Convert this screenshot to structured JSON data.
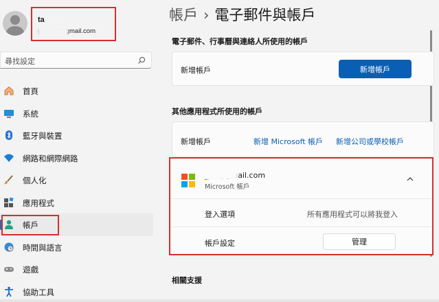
{
  "profile": {
    "name": "ta ",
    "email": "g        01@gmail.com"
  },
  "search": {
    "placeholder": "尋找設定",
    "icon": "search-icon"
  },
  "sidebar": {
    "items": [
      {
        "label": "首頁",
        "icon": "home-icon"
      },
      {
        "label": "系統",
        "icon": "system-icon"
      },
      {
        "label": "藍牙與裝置",
        "icon": "bluetooth-icon"
      },
      {
        "label": "網路和網際網路",
        "icon": "wifi-icon"
      },
      {
        "label": "個人化",
        "icon": "brush-icon"
      },
      {
        "label": "應用程式",
        "icon": "apps-icon"
      },
      {
        "label": "帳戶",
        "icon": "person-icon",
        "active": true
      },
      {
        "label": "時間與語言",
        "icon": "globe-clock-icon"
      },
      {
        "label": "遊戲",
        "icon": "gamepad-icon"
      },
      {
        "label": "協助工具",
        "icon": "accessibility-icon"
      }
    ]
  },
  "breadcrumb": {
    "parent": "帳戶",
    "separator": "›",
    "current": "電子郵件與帳戶"
  },
  "email_section": {
    "title": "電子郵件、行事曆與連絡人所使用的帳戶",
    "row_label": "新增帳戶",
    "button_label": "新增帳戶"
  },
  "other_section": {
    "title": "其他應用程式所使用的帳戶",
    "row_label": "新增帳戶",
    "link_microsoft": "新增 Microsoft 帳戶",
    "link_work": "新增公司或學校帳戶"
  },
  "account": {
    "email": "_01@gmail.com",
    "type": "Microsoft 帳戶",
    "signin_label": "登入選項",
    "signin_value": "所有應用程式可以將我登入",
    "settings_label": "帳戶設定",
    "manage_button": "管理"
  },
  "related": {
    "title": "相關支援"
  },
  "colors": {
    "accent": "#0a5fb4",
    "highlight_border": "#d32f2f",
    "background": "#f3f3f3"
  }
}
